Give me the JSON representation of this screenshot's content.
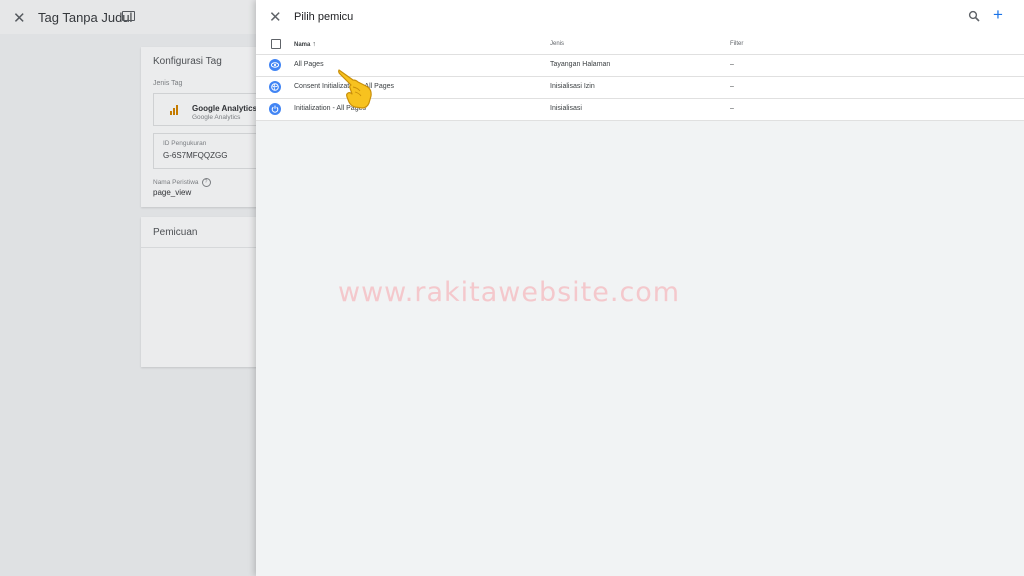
{
  "background_editor": {
    "title": "Tag Tanpa Judul",
    "config_card": {
      "heading": "Konfigurasi Tag",
      "tag_type_label": "Jenis Tag",
      "tag_type_name": "Google Analytics: I",
      "tag_type_sub": "Google Analytics",
      "measurement_id_label": "ID Pengukuran",
      "measurement_id_value": "G-6S7MFQQZGG",
      "event_name_label": "Nama Peristiwa",
      "event_name_value": "page_view"
    },
    "trigger_card": {
      "heading": "Pemicuan"
    }
  },
  "sheet": {
    "title": "Pilih pemicu",
    "columns": {
      "name": "Nama",
      "type": "Jenis",
      "filter": "Filter"
    },
    "rows": [
      {
        "name": "All Pages",
        "type": "Tayangan Halaman",
        "filter": "–",
        "icon": "eye-icon"
      },
      {
        "name": "Consent Initialization - All Pages",
        "type": "Inisialisasi Izin",
        "filter": "–",
        "icon": "globe-icon"
      },
      {
        "name": "Initialization - All Pages",
        "type": "Inisialisasi",
        "filter": "–",
        "icon": "power-icon"
      }
    ]
  },
  "watermark": "www.rakitawebsite.com",
  "colors": {
    "accent": "#1a73e8",
    "trigger_icon": "#4285f4",
    "ga_brand": "#c47b00",
    "watermark": "#f4c8cc"
  }
}
